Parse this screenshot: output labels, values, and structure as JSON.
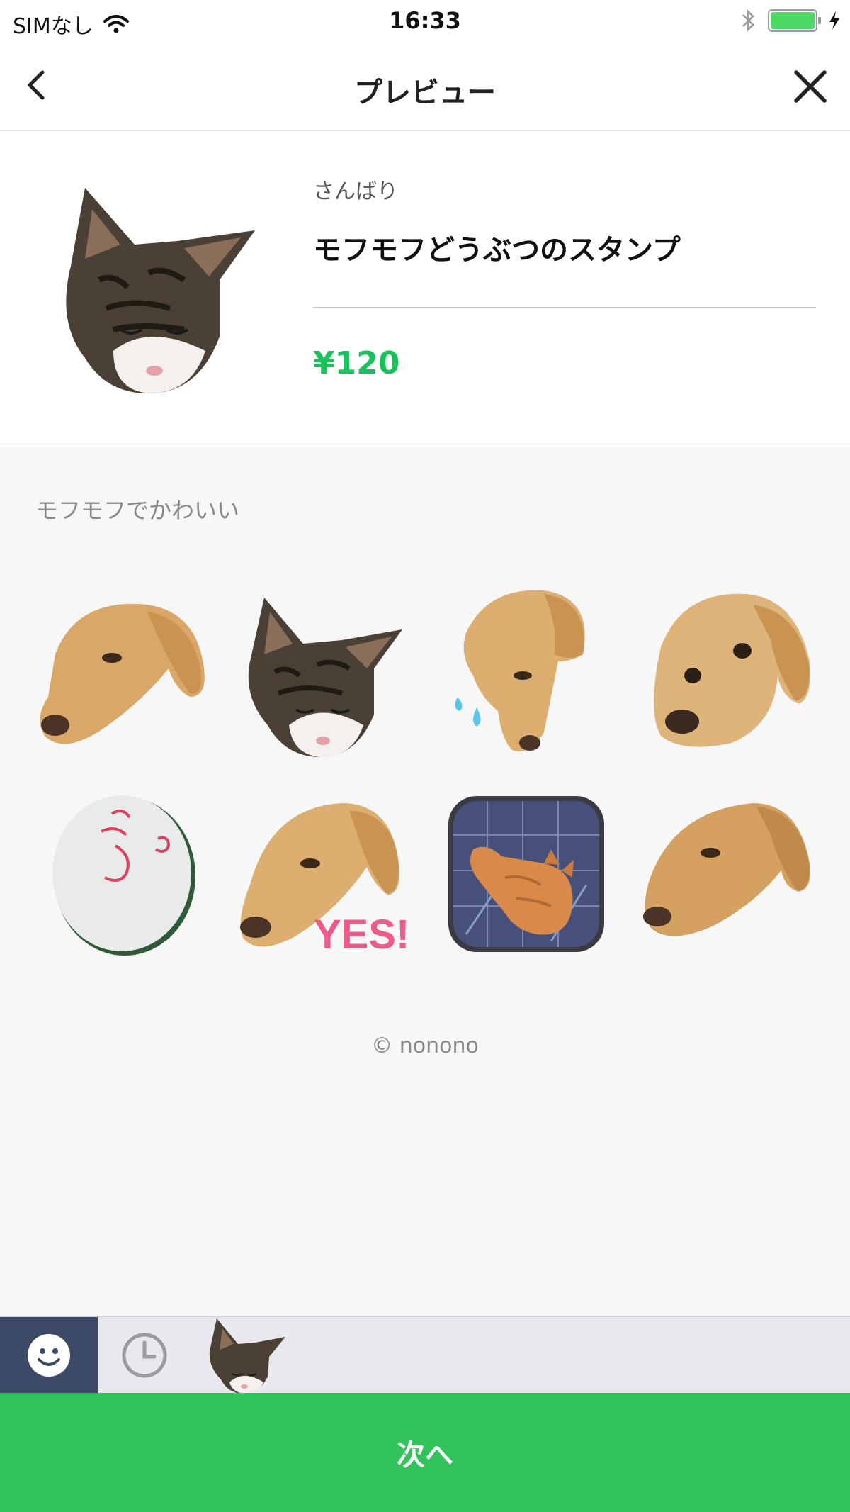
{
  "status_bar": {
    "carrier": "SIMなし",
    "time": "16:33",
    "wifi_icon": "wifi-icon",
    "bluetooth_icon": "bluetooth-icon",
    "battery_icon": "battery-icon",
    "charging_icon": "charging-icon"
  },
  "nav": {
    "title": "プレビュー",
    "back_icon": "chevron-left-icon",
    "close_icon": "close-icon"
  },
  "product": {
    "creator": "さんばり",
    "title": "モフモフどうぶつのスタンプ",
    "price": "¥120",
    "price_color": "#19c15a"
  },
  "description": "モフモフでかわいい",
  "stickers": [
    {
      "name": "dog-head-tilted"
    },
    {
      "name": "tabby-cat-sleepy"
    },
    {
      "name": "dog-head-sweat"
    },
    {
      "name": "dog-face-front"
    },
    {
      "name": "white-ball-face"
    },
    {
      "name": "dog-yes",
      "caption": "YES!!"
    },
    {
      "name": "orange-cat-photo"
    },
    {
      "name": "dog-head-side"
    }
  ],
  "copyright": "© nonono",
  "tabbar": {
    "emoji_tab_icon": "smiley-icon",
    "recent_tab_icon": "clock-icon",
    "sticker_tab_icon": "cat-sticker-icon",
    "active_color": "#3c4a68"
  },
  "next_button": {
    "label": "次へ",
    "color": "#32c35a"
  }
}
